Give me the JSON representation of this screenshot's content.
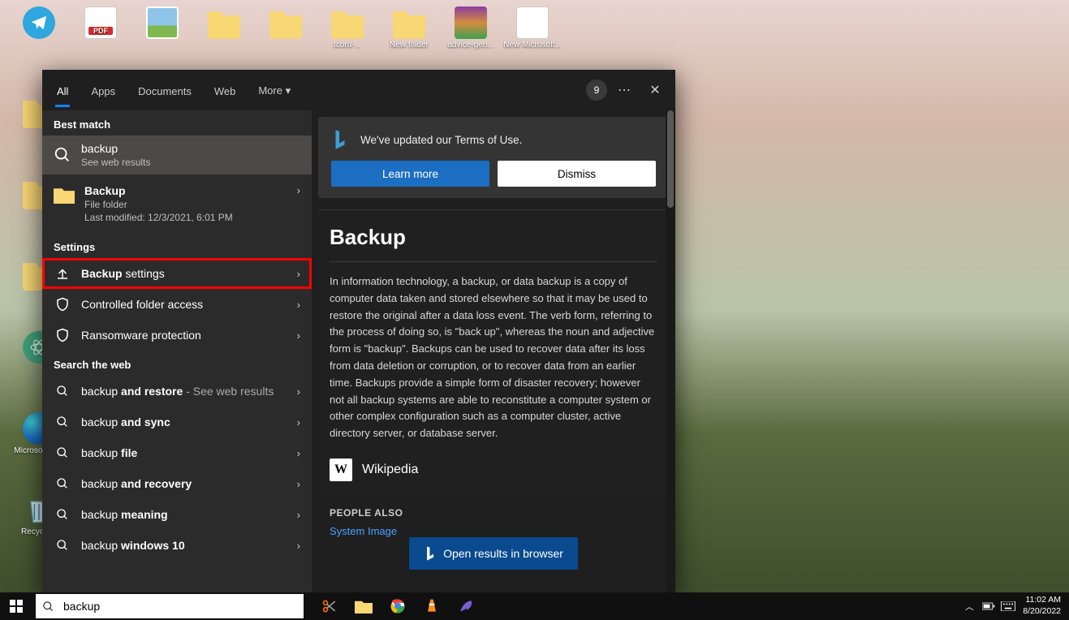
{
  "desktop": {
    "icons": [
      {
        "name": "telegram",
        "label": ""
      },
      {
        "name": "pdf",
        "label": ""
      },
      {
        "name": "image",
        "label": ""
      },
      {
        "name": "folder1",
        "label": ""
      },
      {
        "name": "folder2",
        "label": ""
      },
      {
        "name": "folder3",
        "label": ""
      },
      {
        "name": "folder4",
        "label": ""
      },
      {
        "name": "winrar",
        "label": ""
      },
      {
        "name": "powerpoint",
        "label": ""
      },
      {
        "name": "tcord",
        "label": "tcord-..."
      },
      {
        "name": "newfolder",
        "label": "New folder"
      },
      {
        "name": "advice",
        "label": "advice-gen..."
      },
      {
        "name": "newms",
        "label": "New Microsoft..."
      },
      {
        "name": "edge",
        "label": "Microso Edge"
      },
      {
        "name": "recycle",
        "label": "Recycle..."
      },
      {
        "name": "folder5",
        "label": ""
      },
      {
        "name": "folder6",
        "label": ""
      },
      {
        "name": "folder7",
        "label": ""
      },
      {
        "name": "atom",
        "label": ""
      }
    ]
  },
  "search": {
    "tabs": {
      "all": "All",
      "apps": "Apps",
      "documents": "Documents",
      "web": "Web",
      "more": "More"
    },
    "badge": "9",
    "sections": {
      "bestmatch": "Best match",
      "settings": "Settings",
      "searchweb": "Search the web"
    },
    "bestmatch_item": {
      "title": "backup",
      "sub": "See web results"
    },
    "folder_item": {
      "title": "Backup",
      "sub": "File folder",
      "modified": "Last modified: 12/3/2021, 6:01 PM"
    },
    "settings_items": [
      {
        "prefix": "Backup",
        "suffix": " settings"
      },
      {
        "text": "Controlled folder access"
      },
      {
        "text": "Ransomware protection"
      }
    ],
    "web_items": [
      {
        "prefix": "backup ",
        "bold": "and restore",
        "hint": " - See web results"
      },
      {
        "prefix": "backup ",
        "bold": "and sync"
      },
      {
        "prefix": "backup ",
        "bold": "file"
      },
      {
        "prefix": "backup ",
        "bold": "and recovery"
      },
      {
        "prefix": "backup ",
        "bold": "meaning"
      },
      {
        "prefix": "backup ",
        "bold": "windows 10"
      }
    ],
    "banner": {
      "text": "We've updated our Terms of Use.",
      "learn": "Learn more",
      "dismiss": "Dismiss"
    },
    "card": {
      "title": "Backup",
      "body": "In information technology, a backup, or data backup is a copy of computer data taken and stored elsewhere so that it may be used to restore the original after a data loss event. The verb form, referring to the process of doing so, is \"back up\", whereas the noun and adjective form is \"backup\". Backups can be used to recover data after its loss from data deletion or corruption, or to recover data from an earlier time. Backups provide a simple form of disaster recovery; however not all backup systems are able to reconstitute a computer system or other complex configuration such as a computer cluster, active directory server, or database server.",
      "wikipedia": "Wikipedia"
    },
    "people": {
      "label": "PEOPLE ALSO",
      "link": "System Image"
    },
    "open_browser": "Open results in browser",
    "input_value": "backup"
  },
  "taskbar": {
    "time": "11:02 AM",
    "date": "8/20/2022"
  }
}
